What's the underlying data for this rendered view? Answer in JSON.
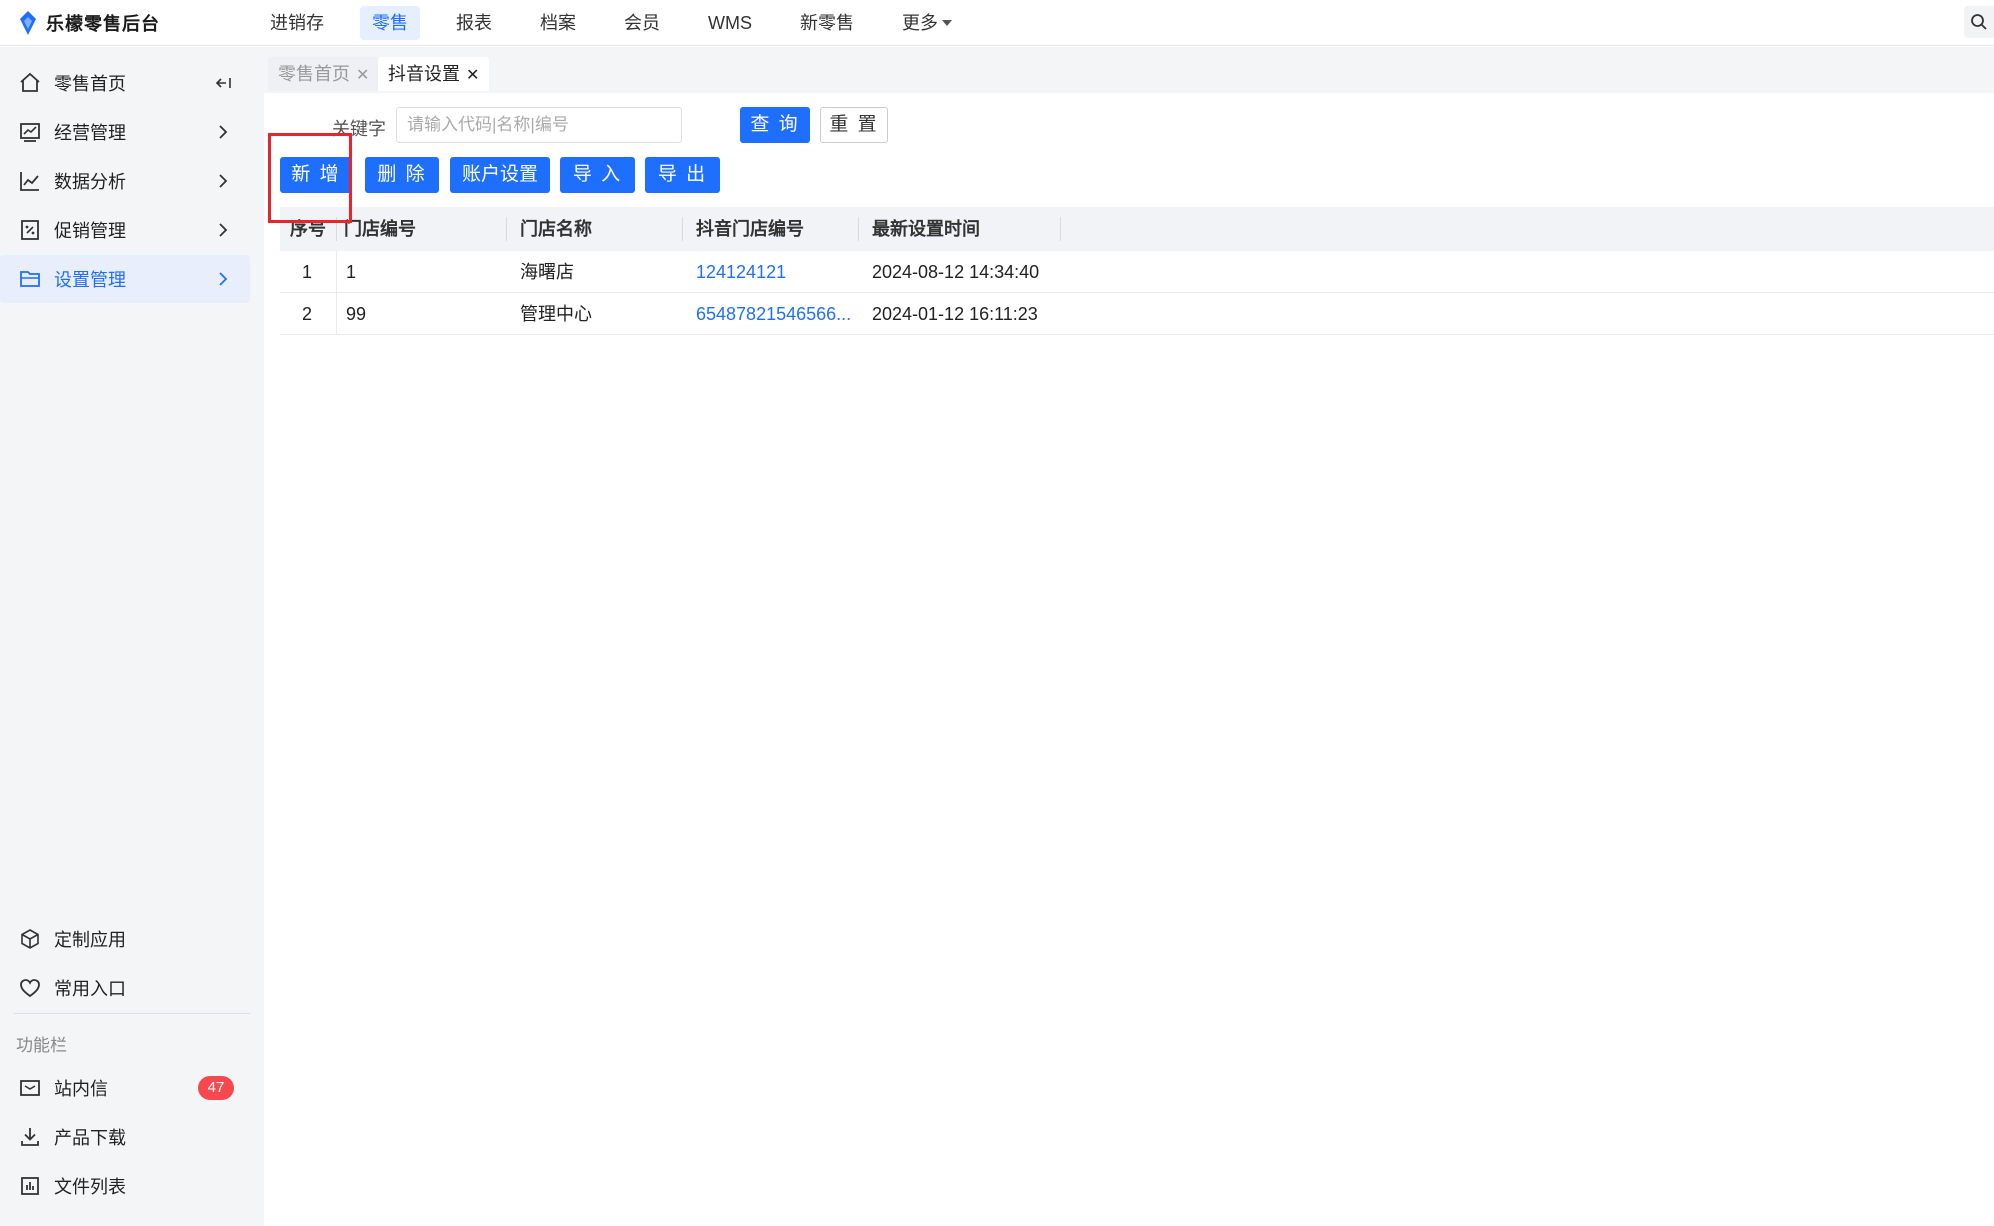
{
  "app": {
    "title": "乐檬零售后台",
    "brand_color": "#1f6fff"
  },
  "topnav": {
    "items": [
      "进销存",
      "零售",
      "报表",
      "档案",
      "会员",
      "WMS",
      "新零售",
      "更多"
    ],
    "active": "零售"
  },
  "sidebar": {
    "items": [
      {
        "label": "零售首页",
        "icon": "home-icon"
      },
      {
        "label": "经营管理",
        "icon": "chart-board-icon"
      },
      {
        "label": "数据分析",
        "icon": "line-chart-icon"
      },
      {
        "label": "促销管理",
        "icon": "promotion-icon"
      },
      {
        "label": "设置管理",
        "icon": "folder-icon"
      }
    ],
    "active": "设置管理",
    "bottom_items": [
      {
        "label": "定制应用",
        "icon": "cube-icon"
      },
      {
        "label": "常用入口",
        "icon": "heart-icon"
      }
    ],
    "section_title": "功能栏",
    "tool_items": [
      {
        "label": "站内信",
        "icon": "mail-icon",
        "badge": "47"
      },
      {
        "label": "产品下载",
        "icon": "download-icon"
      },
      {
        "label": "文件列表",
        "icon": "file-list-icon"
      }
    ]
  },
  "tabs": [
    {
      "label": "零售首页",
      "active": false
    },
    {
      "label": "抖音设置",
      "active": true
    }
  ],
  "filter": {
    "keyword_label": "关键字",
    "keyword_placeholder": "请输入代码|名称|编号",
    "keyword_value": "",
    "query_label": "查 询",
    "reset_label": "重 置"
  },
  "toolbar": {
    "add_label": "新 增",
    "delete_label": "删 除",
    "account_label": "账户设置",
    "import_label": "导 入",
    "export_label": "导 出"
  },
  "table": {
    "columns": [
      "序号",
      "门店编号",
      "门店名称",
      "抖音门店编号",
      "最新设置时间"
    ],
    "rows": [
      {
        "index": "1",
        "store_code": "1",
        "store_name": "海曙店",
        "douyin_code": "124124121",
        "updated": "2024-08-12 14:34:40"
      },
      {
        "index": "2",
        "store_code": "99",
        "store_name": "管理中心",
        "douyin_code": "65487821546566...",
        "updated": "2024-01-12 16:11:23"
      }
    ]
  }
}
